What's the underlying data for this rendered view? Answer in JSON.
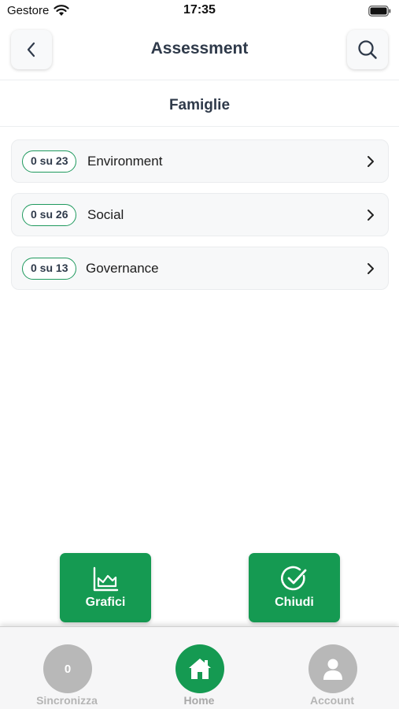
{
  "status_bar": {
    "carrier": "Gestore",
    "time": "17:35"
  },
  "header": {
    "title": "Assessment",
    "back_icon": "chevron-left-icon",
    "search_icon": "search-icon"
  },
  "section": {
    "title": "Famiglie"
  },
  "families": [
    {
      "badge": "0 su 23",
      "label": "Environment"
    },
    {
      "badge": "0 su 26",
      "label": "Social"
    },
    {
      "badge": "0 su 13",
      "label": "Governance"
    }
  ],
  "actions": {
    "grafici_label": "Grafici",
    "chiudi_label": "Chiudi"
  },
  "tab_bar": {
    "sync_count": "0",
    "sync_label": "Sincronizza",
    "home_label": "Home",
    "account_label": "Account"
  },
  "colors": {
    "accent": "#159a52",
    "badge_border": "#1f9a5e",
    "title_text": "#2f3a4a",
    "inactive_tab": "#b8b8b8"
  }
}
